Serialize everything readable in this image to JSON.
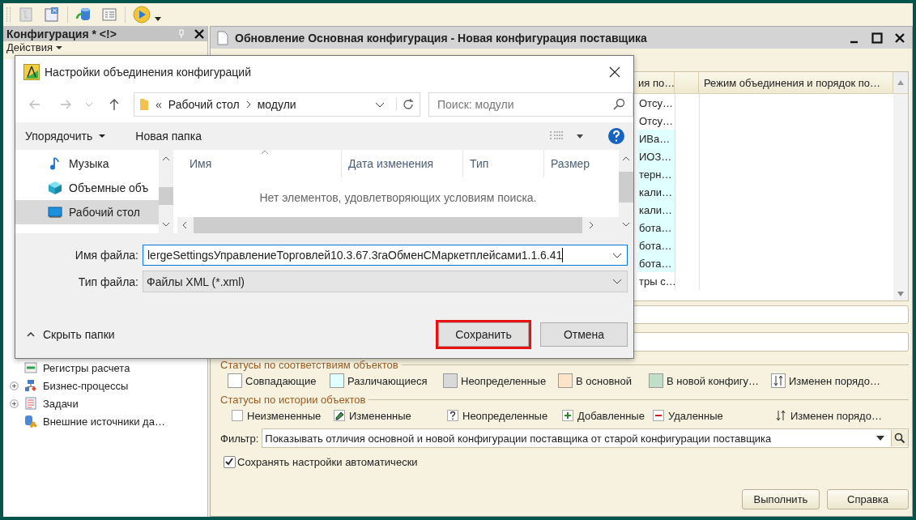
{
  "config_panel": {
    "title": "Конфигурация * <!>",
    "actions_label": "Действия",
    "tree": [
      {
        "label": "Регистры расчета",
        "kind": "register",
        "expandable": false
      },
      {
        "label": "Бизнес-процессы",
        "kind": "process",
        "expandable": true
      },
      {
        "label": "Задачи",
        "kind": "task",
        "expandable": true
      },
      {
        "label": "Внешние источники да…",
        "kind": "source",
        "expandable": false
      }
    ]
  },
  "update_window": {
    "title": "Обновление Основная конфигурация - Новая конфигурация поставщика",
    "table": {
      "columns": [
        "ия по…",
        "Режим объединения и порядок по…"
      ],
      "rows": [
        {
          "column_1": "Отсу…",
          "color": "#ffffff"
        },
        {
          "column_1": "Отсу…",
          "color": "#ffffff"
        },
        {
          "column_1": "ИВа…",
          "color": "#e0ffff"
        },
        {
          "column_1": "ИОЗ…",
          "color": "#e0ffff"
        },
        {
          "column_1": "терн…",
          "color": "#e0ffff"
        },
        {
          "column_1": "кали…",
          "color": "#e0ffff"
        },
        {
          "column_1": "кали…",
          "color": "#e0ffff"
        },
        {
          "column_1": "бота…",
          "color": "#e0ffff"
        },
        {
          "column_1": "бота…",
          "color": "#e0ffff"
        },
        {
          "column_1": "бота…",
          "color": "#e0ffff"
        },
        {
          "column_1": "тры с…",
          "color": "#ffffff"
        }
      ]
    },
    "match_statuses": {
      "title": "Статусы по соответствиям объектов",
      "items": [
        {
          "kind": "swatch",
          "label": "Совпадающие",
          "color": "#ffffff"
        },
        {
          "kind": "swatch",
          "label": "Различающиеся",
          "color": "#e0ffff"
        },
        {
          "kind": "swatch",
          "label": "Неопределенные",
          "color": "#d9d9d9"
        },
        {
          "kind": "swatch",
          "label": "В основной",
          "color": "#fde4c8"
        },
        {
          "kind": "swatch",
          "label": "В новой конфигу…",
          "color": "#bfe0c6"
        },
        {
          "kind": "order",
          "label": "Изменен порядо…"
        }
      ]
    },
    "history_statuses": {
      "title": "Статусы по истории объектов",
      "items": [
        {
          "kind": "blank",
          "label": "Неизмененные"
        },
        {
          "kind": "pencil",
          "label": "Измененные"
        },
        {
          "kind": "question",
          "label": "Неопределенные"
        },
        {
          "kind": "plus",
          "label": "Добавленные"
        },
        {
          "kind": "minus",
          "label": "Удаленные"
        },
        {
          "kind": "order",
          "label": "Изменен порядо…"
        }
      ]
    },
    "filter": {
      "label": "Фильтр:",
      "value": "Показывать отличия основной и новой конфигурации поставщика от старой конфигурации поставщика"
    },
    "autosave": {
      "label": "Сохранять настройки автоматически",
      "checked": true
    },
    "buttons": [
      "Выполнить",
      "Справка"
    ]
  },
  "dialog": {
    "title": "Настройки объединения конфигураций",
    "path_prefix": "«",
    "path": [
      "Рабочий стол",
      "модули"
    ],
    "search": {
      "placeholder": "Поиск: модули"
    },
    "toolbar": {
      "organize": "Упорядочить",
      "new_folder": "Новая папка"
    },
    "nav": [
      {
        "label": "Музыка",
        "kind": "music",
        "selected": false
      },
      {
        "label": "Объемные объ",
        "kind": "objects",
        "selected": false
      },
      {
        "label": "Рабочий стол",
        "kind": "desktop",
        "selected": true
      }
    ],
    "columns": [
      "Имя",
      "Дата изменения",
      "Тип",
      "Размер"
    ],
    "empty_message": "Нет элементов, удовлетворяющих условиям поиска.",
    "file_name": {
      "label": "Имя файла:",
      "value": "lergeSettingsУправлениеТорговлей10.3.67.3гаОбменСМаркетплейсами1.1.6.41"
    },
    "file_type": {
      "label": "Тип файла:",
      "value": "Файлы XML (*.xml)"
    },
    "hide_folders": "Скрыть папки",
    "buttons": [
      {
        "label": "Сохранить",
        "highlighted": true
      },
      {
        "label": "Отмена",
        "highlighted": false
      }
    ]
  }
}
